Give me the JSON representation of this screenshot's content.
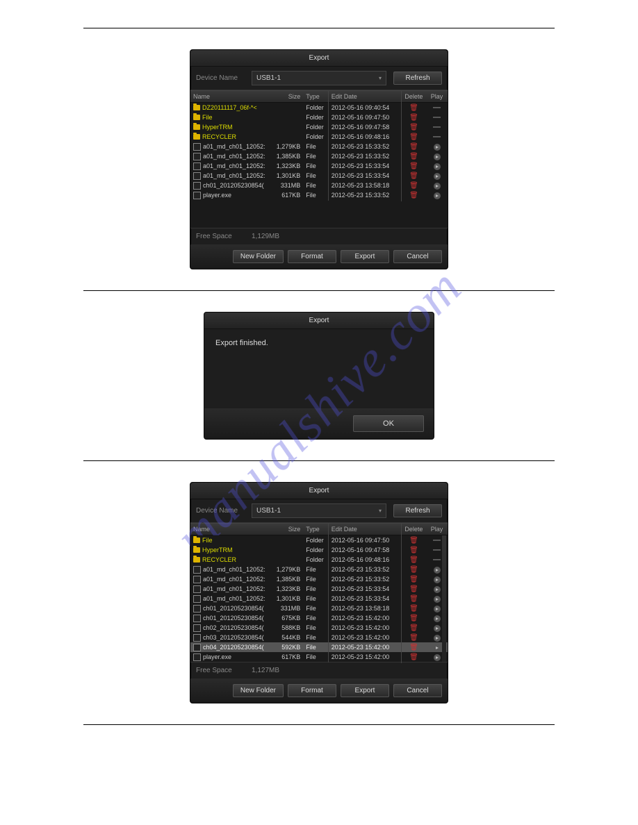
{
  "watermark": "manualshive.com",
  "dialog1": {
    "title": "Export",
    "deviceLabel": "Device Name",
    "deviceValue": "USB1-1",
    "refresh": "Refresh",
    "columns": {
      "name": "Name",
      "size": "Size",
      "type": "Type",
      "date": "Edit Date",
      "del": "Delete",
      "play": "Play"
    },
    "rows": [
      {
        "kind": "folder",
        "name": "DZ20111117_06f-*<",
        "size": "",
        "type": "Folder",
        "date": "2012-05-16 09:40:54"
      },
      {
        "kind": "folder",
        "name": "File",
        "size": "",
        "type": "Folder",
        "date": "2012-05-16 09:47:50"
      },
      {
        "kind": "folder",
        "name": "HyperTRM",
        "size": "",
        "type": "Folder",
        "date": "2012-05-16 09:47:58"
      },
      {
        "kind": "folder",
        "name": "RECYCLER",
        "size": "",
        "type": "Folder",
        "date": "2012-05-16 09:48:16"
      },
      {
        "kind": "file",
        "name": "a01_md_ch01_12052:",
        "size": "1,279KB",
        "type": "File",
        "date": "2012-05-23 15:33:52"
      },
      {
        "kind": "file",
        "name": "a01_md_ch01_12052:",
        "size": "1,385KB",
        "type": "File",
        "date": "2012-05-23 15:33:52"
      },
      {
        "kind": "file",
        "name": "a01_md_ch01_12052:",
        "size": "1,323KB",
        "type": "File",
        "date": "2012-05-23 15:33:54"
      },
      {
        "kind": "file",
        "name": "a01_md_ch01_12052:",
        "size": "1,301KB",
        "type": "File",
        "date": "2012-05-23 15:33:54"
      },
      {
        "kind": "file",
        "name": "ch01_201205230854(",
        "size": "331MB",
        "type": "File",
        "date": "2012-05-23 13:58:18"
      },
      {
        "kind": "file",
        "name": "player.exe",
        "size": "617KB",
        "type": "File",
        "date": "2012-05-23 15:33:52"
      }
    ],
    "freeLabel": "Free Space",
    "freeValue": "1,129MB",
    "buttons": {
      "newFolder": "New Folder",
      "format": "Format",
      "export": "Export",
      "cancel": "Cancel"
    }
  },
  "msg": {
    "title": "Export",
    "body": "Export finished.",
    "ok": "OK"
  },
  "dialog2": {
    "title": "Export",
    "deviceLabel": "Device Name",
    "deviceValue": "USB1-1",
    "refresh": "Refresh",
    "columns": {
      "name": "Name",
      "size": "Size",
      "type": "Type",
      "date": "Edit Date",
      "del": "Delete",
      "play": "Play"
    },
    "rows": [
      {
        "kind": "folder",
        "name": "File",
        "size": "",
        "type": "Folder",
        "date": "2012-05-16 09:47:50"
      },
      {
        "kind": "folder",
        "name": "HyperTRM",
        "size": "",
        "type": "Folder",
        "date": "2012-05-16 09:47:58"
      },
      {
        "kind": "folder",
        "name": "RECYCLER",
        "size": "",
        "type": "Folder",
        "date": "2012-05-16 09:48:16"
      },
      {
        "kind": "file",
        "name": "a01_md_ch01_12052:",
        "size": "1,279KB",
        "type": "File",
        "date": "2012-05-23 15:33:52"
      },
      {
        "kind": "file",
        "name": "a01_md_ch01_12052:",
        "size": "1,385KB",
        "type": "File",
        "date": "2012-05-23 15:33:52"
      },
      {
        "kind": "file",
        "name": "a01_md_ch01_12052:",
        "size": "1,323KB",
        "type": "File",
        "date": "2012-05-23 15:33:54"
      },
      {
        "kind": "file",
        "name": "a01_md_ch01_12052:",
        "size": "1,301KB",
        "type": "File",
        "date": "2012-05-23 15:33:54"
      },
      {
        "kind": "file",
        "name": "ch01_201205230854(",
        "size": "331MB",
        "type": "File",
        "date": "2012-05-23 13:58:18"
      },
      {
        "kind": "file",
        "name": "ch01_201205230854(",
        "size": "675KB",
        "type": "File",
        "date": "2012-05-23 15:42:00"
      },
      {
        "kind": "file",
        "name": "ch02_201205230854(",
        "size": "588KB",
        "type": "File",
        "date": "2012-05-23 15:42:00"
      },
      {
        "kind": "file",
        "name": "ch03_201205230854(",
        "size": "544KB",
        "type": "File",
        "date": "2012-05-23 15:42:00"
      },
      {
        "kind": "file",
        "name": "ch04_201205230854(",
        "size": "592KB",
        "type": "File",
        "date": "2012-05-23 15:42:00",
        "selected": true
      },
      {
        "kind": "file",
        "name": "player.exe",
        "size": "617KB",
        "type": "File",
        "date": "2012-05-23 15:42:00"
      }
    ],
    "freeLabel": "Free Space",
    "freeValue": "1,127MB",
    "buttons": {
      "newFolder": "New Folder",
      "format": "Format",
      "export": "Export",
      "cancel": "Cancel"
    }
  }
}
